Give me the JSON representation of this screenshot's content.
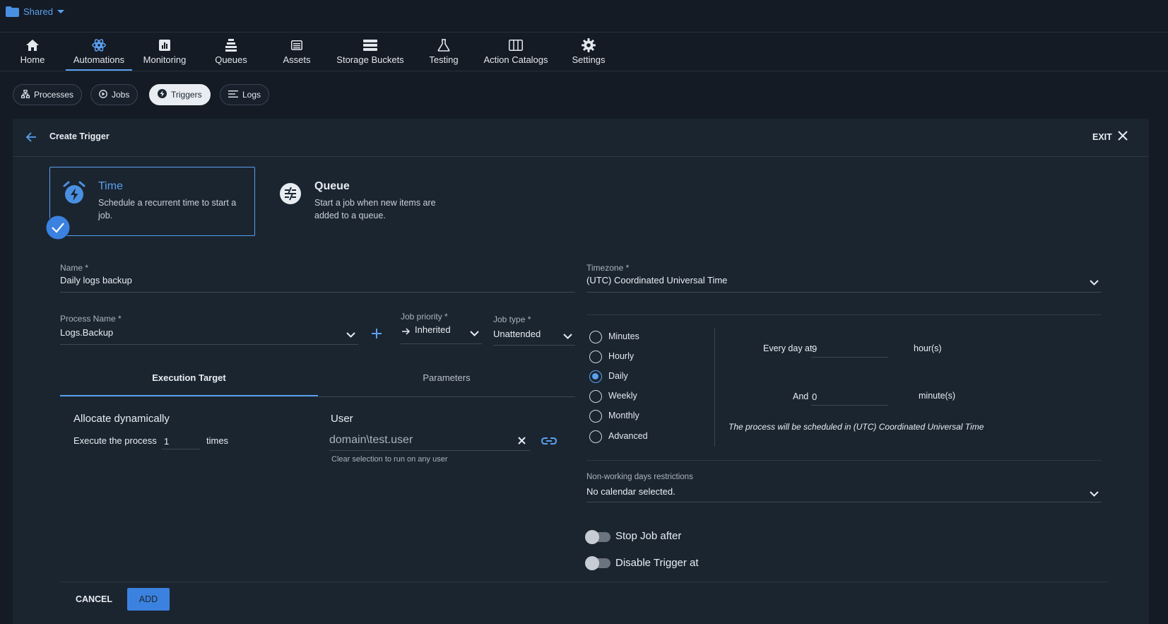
{
  "header": {
    "folder_label": "Shared"
  },
  "nav": [
    {
      "label": "Home",
      "icon": "home-icon"
    },
    {
      "label": "Automations",
      "icon": "automations-icon",
      "active": true
    },
    {
      "label": "Monitoring",
      "icon": "monitoring-icon"
    },
    {
      "label": "Queues",
      "icon": "queues-icon"
    },
    {
      "label": "Assets",
      "icon": "assets-icon"
    },
    {
      "label": "Storage Buckets",
      "icon": "storage-buckets-icon"
    },
    {
      "label": "Testing",
      "icon": "testing-icon"
    },
    {
      "label": "Action Catalogs",
      "icon": "action-catalogs-icon"
    },
    {
      "label": "Settings",
      "icon": "settings-icon"
    }
  ],
  "subnav": [
    {
      "label": "Processes",
      "icon": "processes-icon"
    },
    {
      "label": "Jobs",
      "icon": "jobs-icon"
    },
    {
      "label": "Triggers",
      "icon": "triggers-icon",
      "selected": true
    },
    {
      "label": "Logs",
      "icon": "logs-icon"
    }
  ],
  "panel": {
    "title": "Create Trigger",
    "exit_label": "EXIT"
  },
  "trigger_types": {
    "time": {
      "title": "Time",
      "description": "Schedule a recurrent time to start a job.",
      "selected": true
    },
    "queue": {
      "title": "Queue",
      "description": "Start a job when new items are added to a queue."
    }
  },
  "form": {
    "name_label": "Name *",
    "name_value": "Daily logs backup",
    "timezone_label": "Timezone *",
    "timezone_value": "(UTC) Coordinated Universal Time",
    "process_label": "Process Name *",
    "process_value": "Logs.Backup",
    "priority_label": "Job priority *",
    "priority_value": "Inherited",
    "jobtype_label": "Job type *",
    "jobtype_value": "Unattended"
  },
  "tabs": [
    {
      "label": "Execution Target",
      "active": true
    },
    {
      "label": "Parameters"
    }
  ],
  "execution": {
    "allocate_title": "Allocate dynamically",
    "execute_prefix": "Execute the process",
    "execute_count": "1",
    "execute_suffix": "times",
    "user_title": "User",
    "user_value": "domain\\test.user",
    "user_hint": "Clear selection to run on any user"
  },
  "schedule": {
    "options": [
      "Minutes",
      "Hourly",
      "Daily",
      "Weekly",
      "Monthly",
      "Advanced"
    ],
    "selected": "Daily",
    "every_day_label": "Every day at",
    "hour_value": "9",
    "hour_unit": "hour(s)",
    "and_label": "And",
    "minute_value": "0",
    "minute_unit": "minute(s)",
    "note": "The process will be scheduled in (UTC) Coordinated Universal Time"
  },
  "restrictions": {
    "label": "Non-working days restrictions",
    "value": "No calendar selected."
  },
  "toggles": {
    "stop_job": "Stop Job after",
    "disable_trigger": "Disable Trigger at"
  },
  "footer": {
    "cancel_label": "CANCEL",
    "add_label": "ADD"
  },
  "colors": {
    "accent": "#5aa0f0",
    "background": "#141b24",
    "panel": "#1b2530",
    "button": "#3b82e0"
  }
}
